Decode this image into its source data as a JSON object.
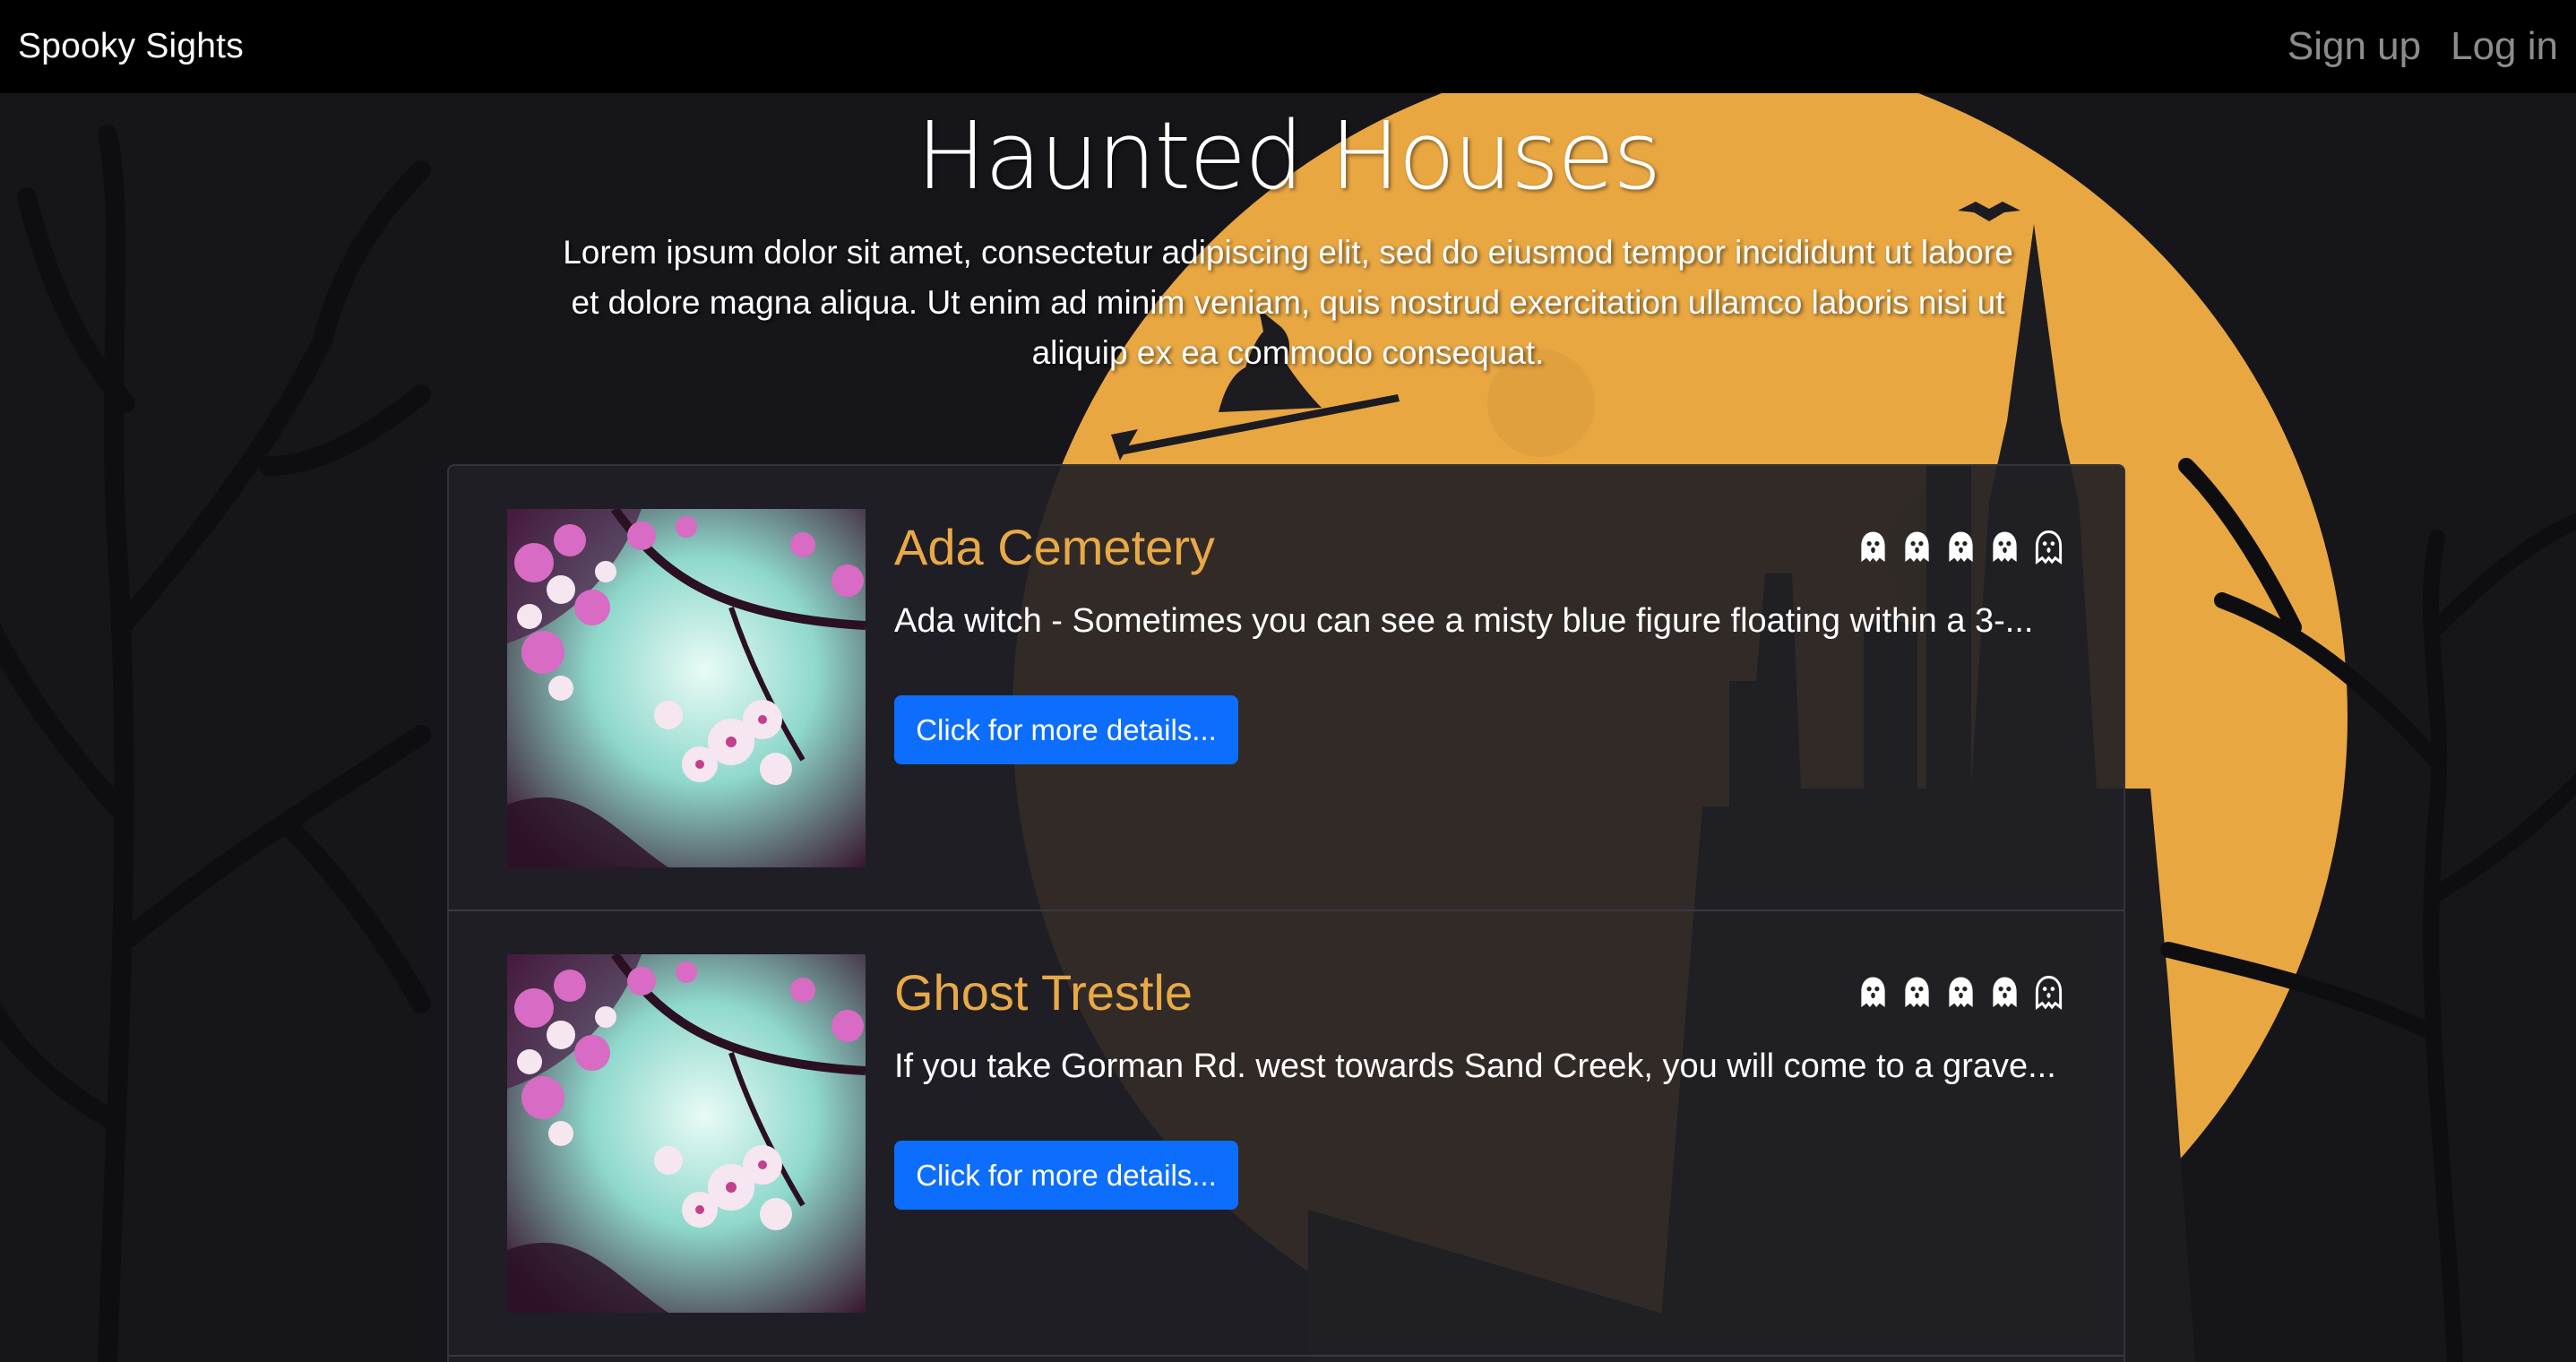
{
  "navbar": {
    "brand": "Spooky Sights",
    "links": [
      {
        "label": "Sign up"
      },
      {
        "label": "Log in"
      }
    ]
  },
  "hero": {
    "title": "Haunted Houses",
    "text": "Lorem ipsum dolor sit amet, consectetur adipiscing elit, sed do eiusmod tempor incididunt ut labore et dolore magna aliqua. Ut enim ad minim veniam, quis nostrud exercitation ullamco laboris nisi ut aliquip ex ea commodo consequat."
  },
  "colors": {
    "accent": "#e8a946",
    "button": "#0d6efd",
    "moon": "#e9a742",
    "navbar": "#000000"
  },
  "locations": [
    {
      "title": "Ada Cemetery",
      "description": "Ada witch - Sometimes you can see a misty blue figure floating within a 3-...",
      "button_label": "Click for more details...",
      "rating": {
        "filled": 4,
        "max": 5,
        "icon": "ghost-icon"
      }
    },
    {
      "title": "Ghost Trestle",
      "description": "If you take Gorman Rd. west towards Sand Creek, you will come to a grave...",
      "button_label": "Click for more details...",
      "rating": {
        "filled": 4,
        "max": 5,
        "icon": "ghost-icon"
      }
    }
  ]
}
